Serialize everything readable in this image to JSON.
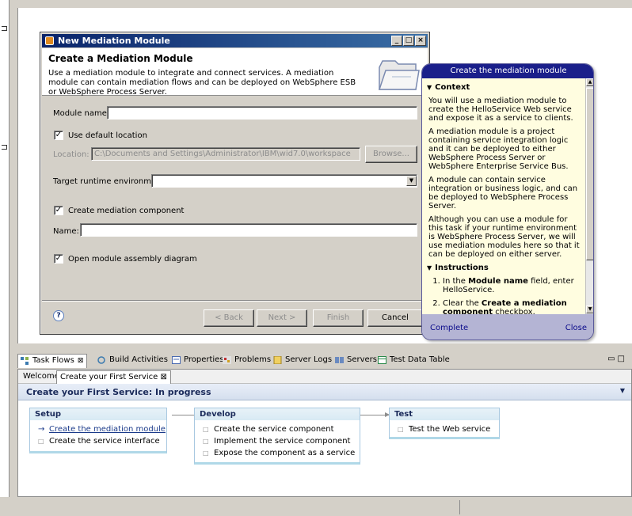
{
  "dialog": {
    "title": "New Mediation Module",
    "heading": "Create a Mediation Module",
    "description": "Use a mediation module to integrate and connect services. A mediation module can contain mediation flows and can be deployed on WebSphere ESB or WebSphere Process Server.",
    "module_name_label": "Module name:",
    "module_name_value": "",
    "use_default_location_label": "Use default location",
    "location_label": "Location:",
    "location_value": "C:\\Documents and Settings\\Administrator\\IBM\\wid7.0\\workspace",
    "browse_label": "Browse...",
    "target_runtime_label": "Target runtime environment:",
    "target_runtime_value": "",
    "create_component_label": "Create mediation component",
    "name_label": "Name:",
    "name_value": "",
    "open_diagram_label": "Open module assembly diagram",
    "back_label": "< Back",
    "next_label": "Next >",
    "finish_label": "Finish",
    "cancel_label": "Cancel",
    "help_glyph": "?"
  },
  "cheat_sheet": {
    "title": "Create the mediation module",
    "context_heading": "Context",
    "context_p1": "You will use a mediation module to create the HelloService Web service and expose it as a service to clients.",
    "context_p2": "A mediation module is a project containing service integration logic and it can be deployed to either WebSphere Process Server or WebSphere Enterprise Service Bus.",
    "context_p3": "A module can contain service integration or business logic, and can be deployed to WebSphere Process Server.",
    "context_p4": "Although you can use a module for this task if your runtime environment is WebSphere Process Server, we will use mediation modules here so that it can be deployed on either server.",
    "instructions_heading": "Instructions",
    "step1_prefix": "In the ",
    "step1_bold": "Module name",
    "step1_suffix": " field, enter HelloService.",
    "step2_prefix": "Clear the ",
    "step2_bold": "Create a mediation component",
    "step2_suffix": " checkbox.",
    "complete_label": "Complete",
    "close_label": "Close"
  },
  "panel": {
    "tabs": [
      {
        "label": "Task Flows",
        "icon": "task-flows-icon"
      },
      {
        "label": "Build Activities",
        "icon": "build-activities-icon"
      },
      {
        "label": "Properties",
        "icon": "properties-icon"
      },
      {
        "label": "Problems",
        "icon": "problems-icon"
      },
      {
        "label": "Server Logs",
        "icon": "server-logs-icon"
      },
      {
        "label": "Servers",
        "icon": "servers-icon"
      },
      {
        "label": "Test Data Table",
        "icon": "test-data-table-icon"
      }
    ],
    "subtabs": [
      "Welcome",
      "Create your First Service"
    ],
    "progress_title": "Create your First Service: In progress",
    "stages": [
      {
        "title": "Setup",
        "items": [
          "Create the mediation module",
          "Create the service interface"
        ]
      },
      {
        "title": "Develop",
        "items": [
          "Create the service component",
          "Implement the service component",
          "Expose the component as a service"
        ]
      },
      {
        "title": "Test",
        "items": [
          "Test the Web service"
        ]
      }
    ]
  },
  "colors": {
    "titlebar": "#0a246a",
    "cheat_title": "#1a1f8a",
    "cheat_bg": "#fffde0",
    "cheat_footer": "#b4b4d4"
  }
}
